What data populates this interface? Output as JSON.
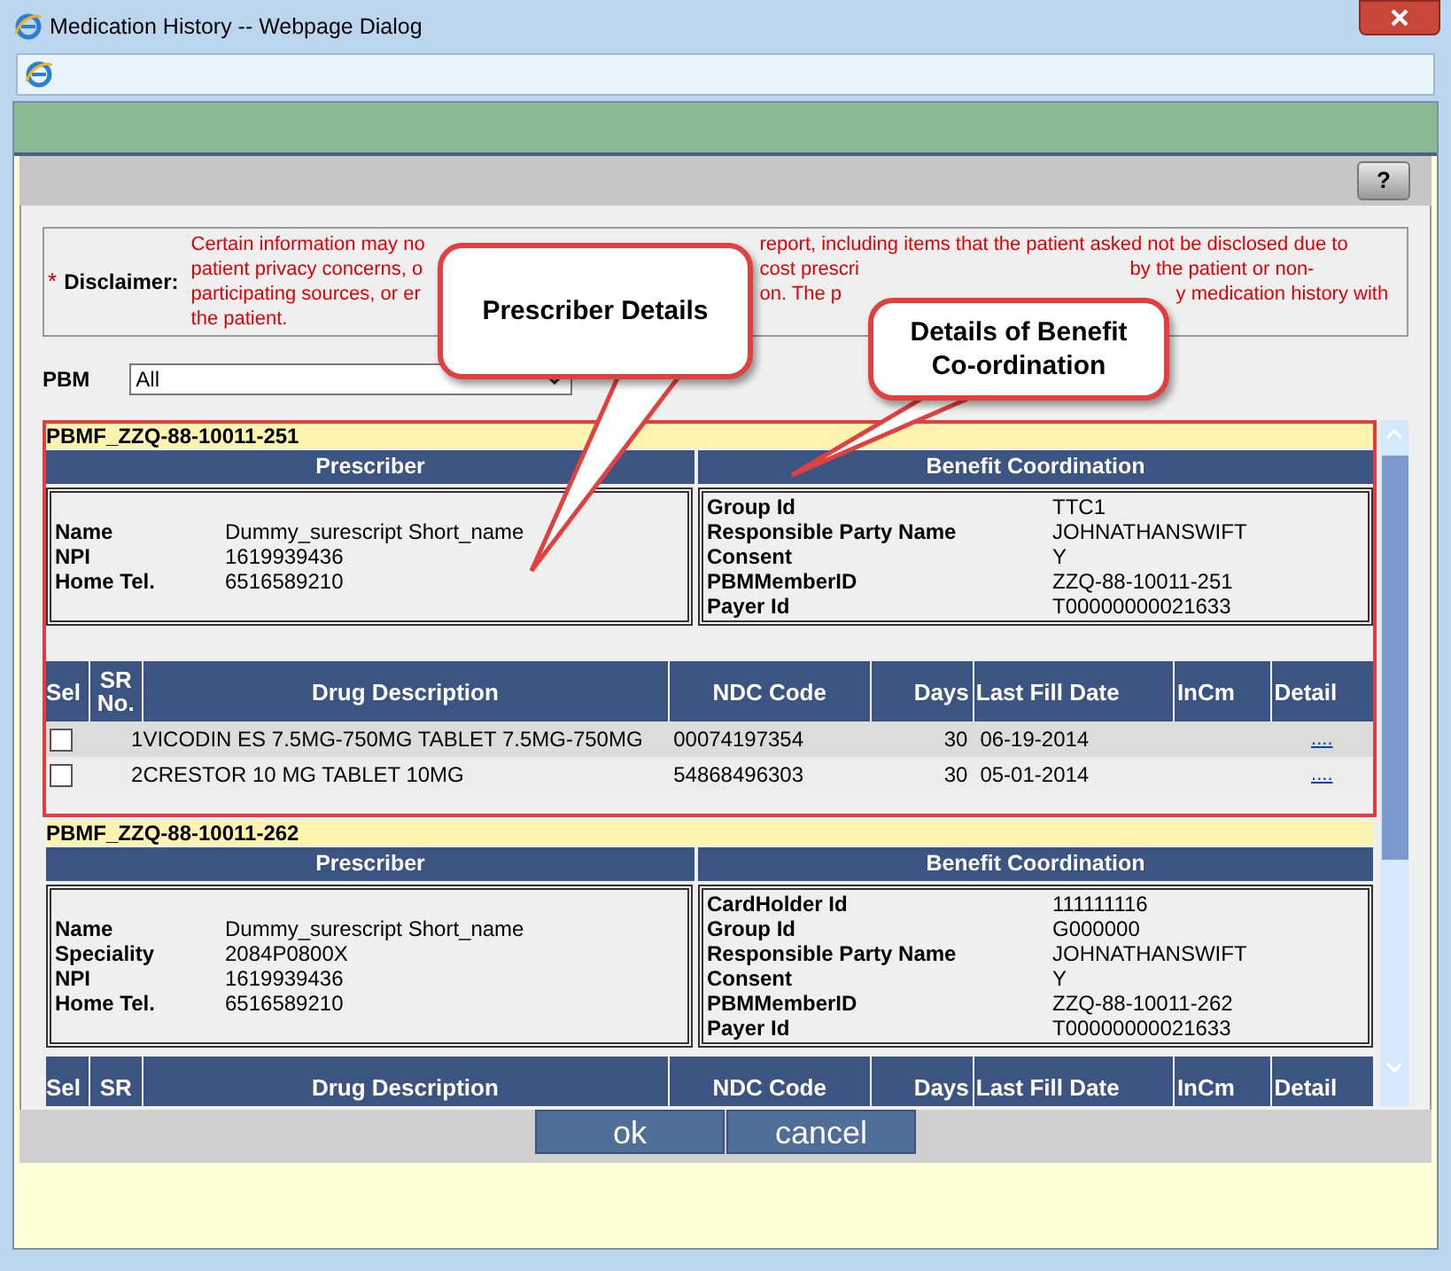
{
  "window": {
    "title": "Medication History -- Webpage Dialog"
  },
  "help_button": "?",
  "disclaimer": {
    "label": "Disclaimer:",
    "required_mark": "*",
    "lines": [
      [
        "Certain information may no",
        "report, including items that the patient asked not be disclosed due to"
      ],
      [
        "patient privacy concerns, o",
        "cost prescri",
        "by the patient or non-"
      ],
      [
        "participating sources, or er",
        "on. The p",
        "y medication history with"
      ],
      [
        "the patient."
      ]
    ]
  },
  "pbm": {
    "label": "PBM",
    "value": "All"
  },
  "records": [
    {
      "id": "PBMF_ZZQ-88-10011-251",
      "highlighted": true,
      "prescriber_heading": "Prescriber",
      "benefit_heading": "Benefit Coordination",
      "prescriber": [
        {
          "label": "Name",
          "value": "Dummy_surescript Short_name"
        },
        {
          "label": "NPI",
          "value": "1619939436"
        },
        {
          "label": "Home Tel.",
          "value": "6516589210"
        }
      ],
      "benefit": [
        {
          "label": "Group Id",
          "value": "TTC1"
        },
        {
          "label": "Responsible Party Name",
          "value": "JOHNATHANSWIFT"
        },
        {
          "label": "Consent",
          "value": "Y"
        },
        {
          "label": "PBMMemberID",
          "value": "ZZQ-88-10011-251"
        },
        {
          "label": "Payer Id",
          "value": "T00000000021633"
        }
      ],
      "columns": [
        "Sel",
        "SR No.",
        "Drug Description",
        "NDC Code",
        "Days",
        "Last Fill Date",
        "InCm",
        "Detail"
      ],
      "rows": [
        {
          "checked": false,
          "sr": "1",
          "description": "VICODIN ES 7.5MG-750MG TABLET 7.5MG-750MG",
          "ndc": "00074197354",
          "days": "30",
          "last_fill": "06-19-2014",
          "detail": "...."
        },
        {
          "checked": false,
          "sr": "2",
          "description": "CRESTOR 10 MG TABLET 10MG",
          "ndc": "54868496303",
          "days": "30",
          "last_fill": "05-01-2014",
          "detail": "...."
        }
      ]
    },
    {
      "id": "PBMF_ZZQ-88-10011-262",
      "highlighted": false,
      "prescriber_heading": "Prescriber",
      "benefit_heading": "Benefit Coordination",
      "prescriber": [
        {
          "label": "Name",
          "value": "Dummy_surescript Short_name"
        },
        {
          "label": "Speciality",
          "value": "2084P0800X"
        },
        {
          "label": "NPI",
          "value": "1619939436"
        },
        {
          "label": "Home Tel.",
          "value": "6516589210"
        }
      ],
      "benefit": [
        {
          "label": "CardHolder Id",
          "value": "111111116"
        },
        {
          "label": "Group Id",
          "value": "G000000"
        },
        {
          "label": "Responsible Party Name",
          "value": "JOHNATHANSWIFT"
        },
        {
          "label": "Consent",
          "value": "Y"
        },
        {
          "label": "PBMMemberID",
          "value": "ZZQ-88-10011-262"
        },
        {
          "label": "Payer Id",
          "value": "T00000000021633"
        }
      ],
      "columns": [
        "Sel",
        "SR",
        "Drug Description",
        "NDC Code",
        "Days",
        "Last Fill Date",
        "InCm",
        "Detail"
      ]
    }
  ],
  "buttons": [
    "ok",
    "cancel"
  ],
  "callouts": [
    {
      "text": "Prescriber Details"
    },
    {
      "text": "Details of Benefit Co-ordination"
    }
  ]
}
